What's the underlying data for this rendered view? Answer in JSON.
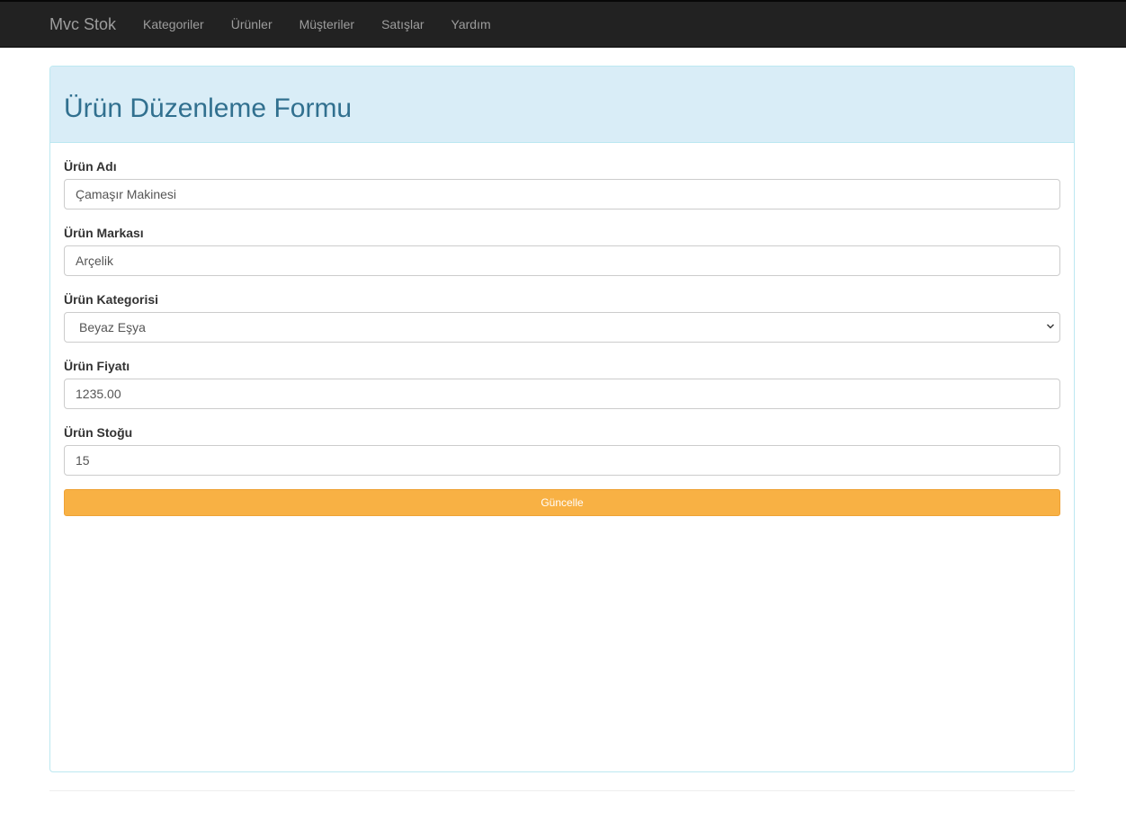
{
  "navbar": {
    "brand": "Mvc Stok",
    "items": [
      {
        "label": "Kategoriler"
      },
      {
        "label": "Ürünler"
      },
      {
        "label": "Müşteriler"
      },
      {
        "label": "Satışlar"
      },
      {
        "label": "Yardım"
      }
    ]
  },
  "form": {
    "title": "Ürün Düzenleme Formu",
    "fields": {
      "name": {
        "label": "Ürün Adı",
        "value": "Çamaşır Makinesi"
      },
      "brand": {
        "label": "Ürün Markası",
        "value": "Arçelik"
      },
      "category": {
        "label": "Ürün Kategorisi",
        "selected": "Beyaz Eşya"
      },
      "price": {
        "label": "Ürün Fiyatı",
        "value": "1235.00"
      },
      "stock": {
        "label": "Ürün Stoğu",
        "value": "15"
      }
    },
    "submit_label": "Güncelle"
  },
  "colors": {
    "navbar_bg": "#222222",
    "heading_bg": "#d9edf7",
    "heading_text": "#31708f",
    "button_bg": "#f8b144"
  }
}
